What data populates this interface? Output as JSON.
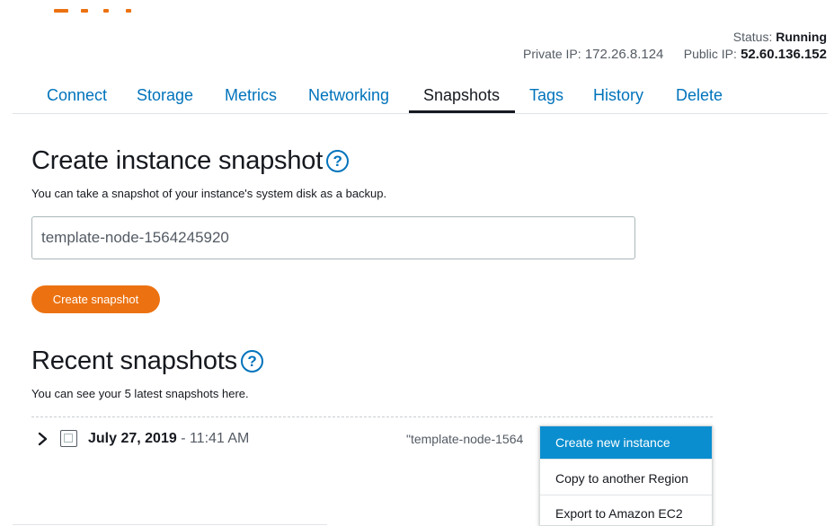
{
  "header": {
    "status_label": "Status:",
    "status_value": "Running",
    "private_ip_label": "Private IP:",
    "private_ip_value": "172.26.8.124",
    "public_ip_label": "Public IP:",
    "public_ip_value": "52.60.136.152"
  },
  "tabs": [
    {
      "label": "Connect"
    },
    {
      "label": "Storage"
    },
    {
      "label": "Metrics"
    },
    {
      "label": "Networking"
    },
    {
      "label": "Snapshots",
      "active": true
    },
    {
      "label": "Tags"
    },
    {
      "label": "History"
    },
    {
      "label": "Delete"
    }
  ],
  "create_section": {
    "title": "Create instance snapshot",
    "help_icon": "?",
    "description": "You can take a snapshot of your instance's system disk as a backup.",
    "input_value": "template-node-1564245920",
    "button_label": "Create snapshot"
  },
  "recent_section": {
    "title": "Recent snapshots",
    "help_icon": "?",
    "description": "You can see your 5 latest snapshots here."
  },
  "snapshot_row": {
    "date": "July 27, 2019",
    "separator": " - ",
    "time": "11:41 AM",
    "name": "\"template-node-1564"
  },
  "context_menu": {
    "items": [
      {
        "label": "Create new instance",
        "highlighted": true
      },
      {
        "label": "Copy to another Region"
      },
      {
        "label": "Export to Amazon EC2"
      }
    ]
  },
  "colors": {
    "accent_orange": "#ec7211",
    "link_blue": "#0073bb",
    "menu_highlight": "#0a8ecf",
    "text_dark": "#16191f",
    "text_muted": "#545b64"
  },
  "icons": {
    "help": "question-circle-icon",
    "expand": "chevron-right-icon",
    "select": "checkbox-icon"
  }
}
